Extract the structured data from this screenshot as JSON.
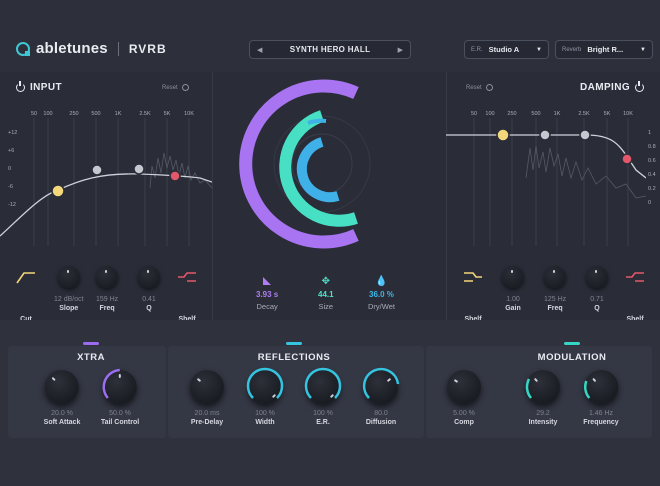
{
  "brand": {
    "name": "abletunes",
    "product": "RVRB"
  },
  "preset": {
    "name": "SYNTH HERO HALL",
    "prev_icon": "triangle-left",
    "next_icon": "triangle-right"
  },
  "er_select": {
    "label": "E.R.",
    "value": "Studio A"
  },
  "reverb_select": {
    "label": "Reverb",
    "value": "Bright R..."
  },
  "input_eq": {
    "title": "INPUT",
    "reset": "Reset",
    "freqs": [
      "50",
      "100",
      "250",
      "500",
      "1K",
      "2.5K",
      "5K",
      "10K"
    ],
    "db": [
      "+12",
      "+6",
      "0",
      "-6",
      "-12"
    ],
    "controls": [
      {
        "label": "Cut",
        "value": "",
        "icon": "high-pass-icon"
      },
      {
        "label": "Slope",
        "value": "12 dB/oct"
      },
      {
        "label": "Freq",
        "value": "159 Hz"
      },
      {
        "label": "Q",
        "value": "0.41"
      },
      {
        "label": "Shelf",
        "value": "",
        "icon": "shelf-icon"
      }
    ]
  },
  "damping_eq": {
    "title": "DAMPING",
    "reset": "Reset",
    "freqs": [
      "50",
      "100",
      "250",
      "500",
      "1K",
      "2.5K",
      "5K",
      "10K"
    ],
    "scale": [
      "1",
      "0.8",
      "0.6",
      "0.4",
      "0.2",
      "0"
    ],
    "controls": [
      {
        "label": "Shelf",
        "value": "",
        "icon": "shelf-icon"
      },
      {
        "label": "Gain",
        "value": "1.00"
      },
      {
        "label": "Freq",
        "value": "125 Hz"
      },
      {
        "label": "Q",
        "value": "0.71"
      },
      {
        "label": "Shelf",
        "value": "",
        "icon": "shelf-icon"
      }
    ]
  },
  "mix": [
    {
      "label": "Decay",
      "value": "3.93 s",
      "icon": "decay-icon",
      "color": "#b07cf0"
    },
    {
      "label": "Size",
      "value": "44.1",
      "icon": "size-icon",
      "color": "#4fe0c8"
    },
    {
      "label": "Dry/Wet",
      "value": "36.0 %",
      "icon": "drops-icon",
      "color": "#3fb6e6"
    }
  ],
  "sections": {
    "xtra": {
      "title": "XTRA",
      "color": "#9b6cf0",
      "controls": [
        {
          "label": "Soft Attack",
          "value": "20.0 %"
        },
        {
          "label": "Tail Control",
          "value": "50.0 %"
        }
      ]
    },
    "reflections": {
      "title": "REFLECTIONS",
      "color": "#35c4e0",
      "controls": [
        {
          "label": "Pre-Delay",
          "value": "20.0 ms"
        },
        {
          "label": "Width",
          "value": "100 %"
        },
        {
          "label": "E.R.",
          "value": "100 %"
        },
        {
          "label": "Diffusion",
          "value": "80.0"
        }
      ]
    },
    "modulation": {
      "title": "MODULATION",
      "color": "#35d6c4",
      "controls": [
        {
          "label": "Comp",
          "value": "5.00 %"
        },
        {
          "label": "Intensity",
          "value": "29.2"
        },
        {
          "label": "Frequency",
          "value": "1.46 Hz"
        }
      ]
    }
  },
  "colors": {
    "bg": "#2a2d38",
    "accent_purple": "#a874f2",
    "accent_teal": "#47e0c4",
    "accent_blue": "#3fb0e8",
    "red_node": "#e2586a",
    "yellow_node": "#f3d77a"
  }
}
